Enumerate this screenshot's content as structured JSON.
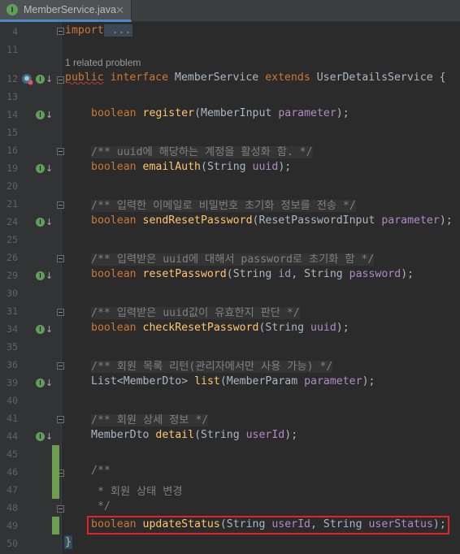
{
  "tab": {
    "filename": "MemberService.java",
    "icon_letter": "I",
    "close": "✕"
  },
  "lines": {
    "l4": "4",
    "l11": "11",
    "l12": "12",
    "l13": "13",
    "l14": "14",
    "l15": "15",
    "l16": "16",
    "l19": "19",
    "l20": "20",
    "l21": "21",
    "l24": "24",
    "l25": "25",
    "l26": "26",
    "l29": "29",
    "l30": "30",
    "l31": "31",
    "l34": "34",
    "l35": "35",
    "l36": "36",
    "l39": "39",
    "l40": "40",
    "l41": "41",
    "l44": "44",
    "l45": "45",
    "l46": "46",
    "l47": "47",
    "l48": "48",
    "l49": "49",
    "l50": "50"
  },
  "code": {
    "import_kw": "import",
    "import_fold": " ...",
    "related_problem": "1 related problem",
    "public": "public",
    "interface": "interface",
    "iface_name": "MemberService",
    "extends": "extends",
    "super_name": "UserDetailsService",
    "open_brace": "{",
    "boolean": "boolean",
    "register": "register",
    "register_type": "MemberInput",
    "register_param": "parameter",
    "c16": "/** uuid에 해당하는 계정을 활성화 함. */",
    "emailAuth": "emailAuth",
    "string": "String",
    "uuid": "uuid",
    "c21": "/** 입력한 이메일로 비밀번호 초기화 정보를 전송 */",
    "sendReset": "sendResetPassword",
    "resetInput": "ResetPasswordInput",
    "c26": "/** 입력받은 uuid에 대해서 password로 초기화 함 */",
    "resetPassword": "resetPassword",
    "id": "id",
    "password": "password",
    "c31": "/** 입력받은 uuid값이 유효한지 판단 */",
    "checkReset": "checkResetPassword",
    "c36": "/** 회원 목록 리턴(관리자에서만 사용 가능) */",
    "list_type": "List",
    "member_dto": "MemberDto",
    "list_fn": "list",
    "member_param": "MemberParam",
    "c41": "/** 회원 상세 정보 */",
    "detail": "detail",
    "userId": "userId",
    "c46": "/**",
    "c47": " * 회원 상태 변경",
    "c48": " */",
    "updateStatus": "updateStatus",
    "userStatus": "userStatus",
    "close_brace": "}"
  },
  "colors": {
    "keyword": "#cc7832",
    "method": "#ffc66d",
    "param": "#b389c5",
    "comment": "#808080",
    "highlight": "#e0242c"
  },
  "icons": {
    "implemented": "implemented-method-icon",
    "problem": "problem-bulb-icon",
    "fold": "fold-marker-icon"
  }
}
